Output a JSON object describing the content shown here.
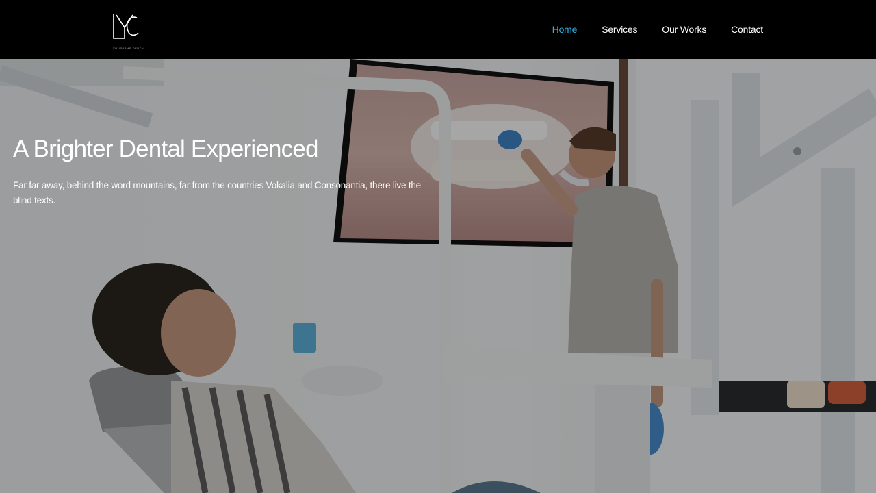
{
  "brand": {
    "logo_letters": "YC",
    "tagline": "YOURNAME DENTAL"
  },
  "nav": {
    "items": [
      {
        "label": "Home",
        "active": true
      },
      {
        "label": "Services",
        "active": false
      },
      {
        "label": "Our Works",
        "active": false
      },
      {
        "label": "Contact",
        "active": false
      }
    ]
  },
  "hero": {
    "title": "A Brighter Dental Experienced",
    "text": "Far far away, behind the word mountains, far from the countries Vokalia and Consonantia, there live the blind texts."
  },
  "colors": {
    "accent": "#2bb3e3",
    "navbar_bg": "#000000",
    "text": "#ffffff"
  }
}
